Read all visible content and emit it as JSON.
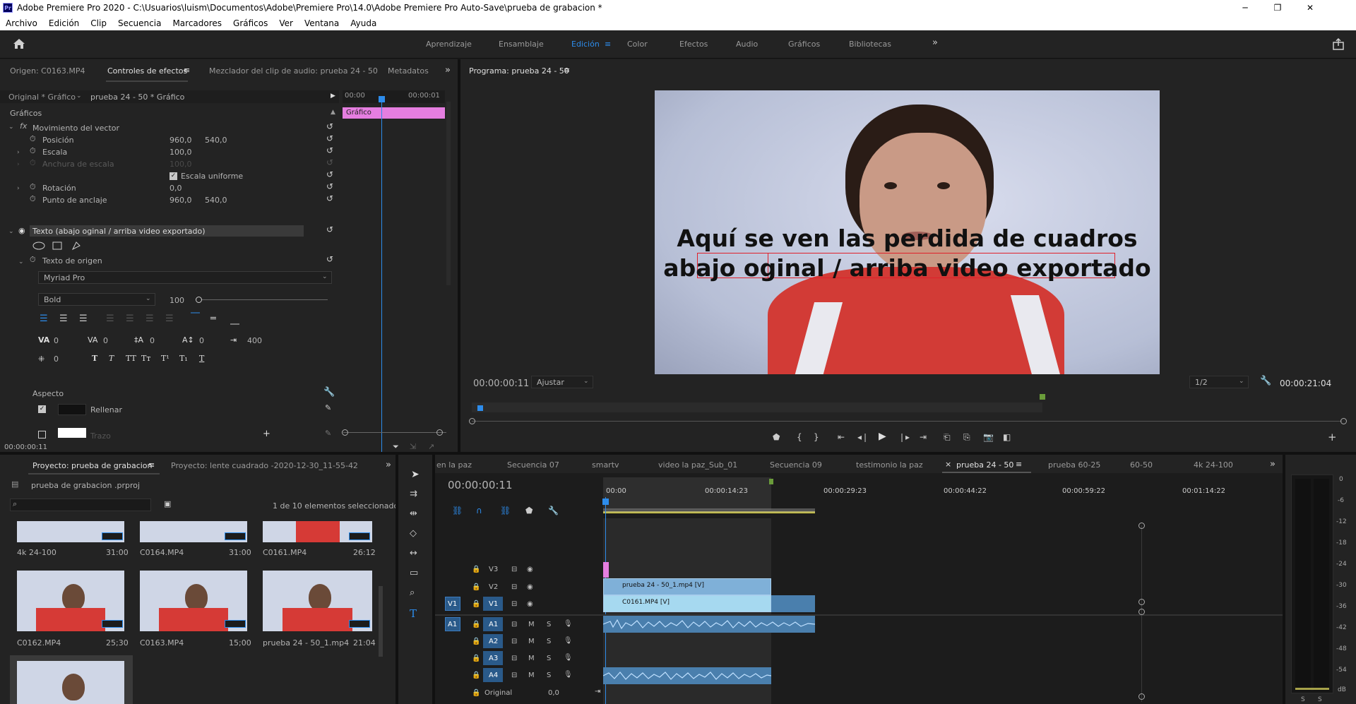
{
  "titlebar": {
    "title": "Adobe Premiere Pro 2020 - C:\\Usuarios\\luism\\Documentos\\Adobe\\Premiere Pro\\14.0\\Adobe Premiere Pro Auto-Save\\prueba de grabacion *"
  },
  "menu": [
    "Archivo",
    "Edición",
    "Clip",
    "Secuencia",
    "Marcadores",
    "Gráficos",
    "Ver",
    "Ventana",
    "Ayuda"
  ],
  "workspaces": [
    "Aprendizaje",
    "Ensamblaje",
    "Edición",
    "Color",
    "Efectos",
    "Audio",
    "Gráficos",
    "Bibliotecas"
  ],
  "workspace_active": "Edición",
  "source_panel": {
    "tabs": [
      "Origen: C0163.MP4",
      "Controles de efectos",
      "Mezclador del clip de audio: prueba 24 - 50",
      "Metadatos"
    ],
    "header_left": "Original * Gráfico",
    "header_right": "prueba 24 - 50 * Gráfico",
    "time_start": "00:00",
    "time_end": "00:00:01",
    "section": "Gráficos",
    "clip_label": "Gráfico",
    "vector_motion": "Movimiento del vector",
    "rows": [
      {
        "label": "Posición",
        "v1": "960,0",
        "v2": "540,0"
      },
      {
        "label": "Escala",
        "v1": "100,0",
        "v2": ""
      },
      {
        "label": "Anchura de escala",
        "v1": "100,0",
        "v2": ""
      },
      {
        "label": "Escala uniforme",
        "v1": "",
        "v2": ""
      },
      {
        "label": "Rotación",
        "v1": "0,0",
        "v2": ""
      },
      {
        "label": "Punto de anclaje",
        "v1": "960,0",
        "v2": "540,0"
      }
    ],
    "text_layer": "Texto (abajo oginal / arriba video exportado)",
    "source_text": "Texto de origen",
    "font": "Myriad Pro",
    "style": "Bold",
    "size": "100",
    "typo_vals": [
      "0",
      "0",
      "0",
      "0",
      "400",
      "0"
    ],
    "aspect": "Aspecto",
    "fill": "Rellenar",
    "stroke": "Trazo",
    "timecode": "00:00:00:11"
  },
  "program": {
    "title": "Programa: prueba 24 - 50",
    "line1": "Aquí se ven las perdida de cuadros",
    "line2": "abajo oginal / arriba video exportado",
    "timecode": "00:00:00:11",
    "fit": "Ajustar",
    "quality": "1/2",
    "duration": "00:00:21:04"
  },
  "project": {
    "tabs": [
      "Proyecto: prueba de grabacion",
      "Proyecto: lente cuadrado -2020-12-30_11-55-42"
    ],
    "file": "prueba de grabacion .prproj",
    "selection": "1 de 10 elementos seleccionados",
    "items": [
      {
        "name": "4k 24-100",
        "dur": "31:00"
      },
      {
        "name": "C0164.MP4",
        "dur": "31:00"
      },
      {
        "name": "C0161.MP4",
        "dur": "26:12"
      },
      {
        "name": "C0162.MP4",
        "dur": "25;30"
      },
      {
        "name": "C0163.MP4",
        "dur": "15;00"
      },
      {
        "name": "prueba 24 - 50_1.mp4",
        "dur": "21:04"
      }
    ]
  },
  "timeline": {
    "tabs": [
      "en la paz",
      "Secuencia 07",
      "smartv",
      "video la paz_Sub_01",
      "Secuencia 09",
      "testimonio la paz",
      "prueba 24 - 50",
      "prueba 60-25",
      "60-50",
      "4k 24-100"
    ],
    "active_tab": "prueba 24 - 50",
    "timecode": "00:00:00:11",
    "ruler": [
      "00:00",
      "00:00:14:23",
      "00:00:29:23",
      "00:00:44:22",
      "00:00:59:22",
      "00:01:14:22"
    ],
    "video_tracks": [
      "V3",
      "V2",
      "V1"
    ],
    "audio_tracks": [
      "A1",
      "A2",
      "A3",
      "A4"
    ],
    "src_v": "V1",
    "src_a": "A1",
    "clip_v2": "prueba 24 - 50_1.mp4 [V]",
    "clip_v1": "C0161.MP4 [V]",
    "original_label": "Original",
    "original_val": "0,0",
    "m": "M",
    "s": "S"
  },
  "meter": {
    "labels": [
      "0",
      "-6",
      "-12",
      "-18",
      "-24",
      "-30",
      "-36",
      "-42",
      "-48",
      "-54",
      "dB"
    ],
    "bottom": [
      "S",
      "S"
    ]
  }
}
